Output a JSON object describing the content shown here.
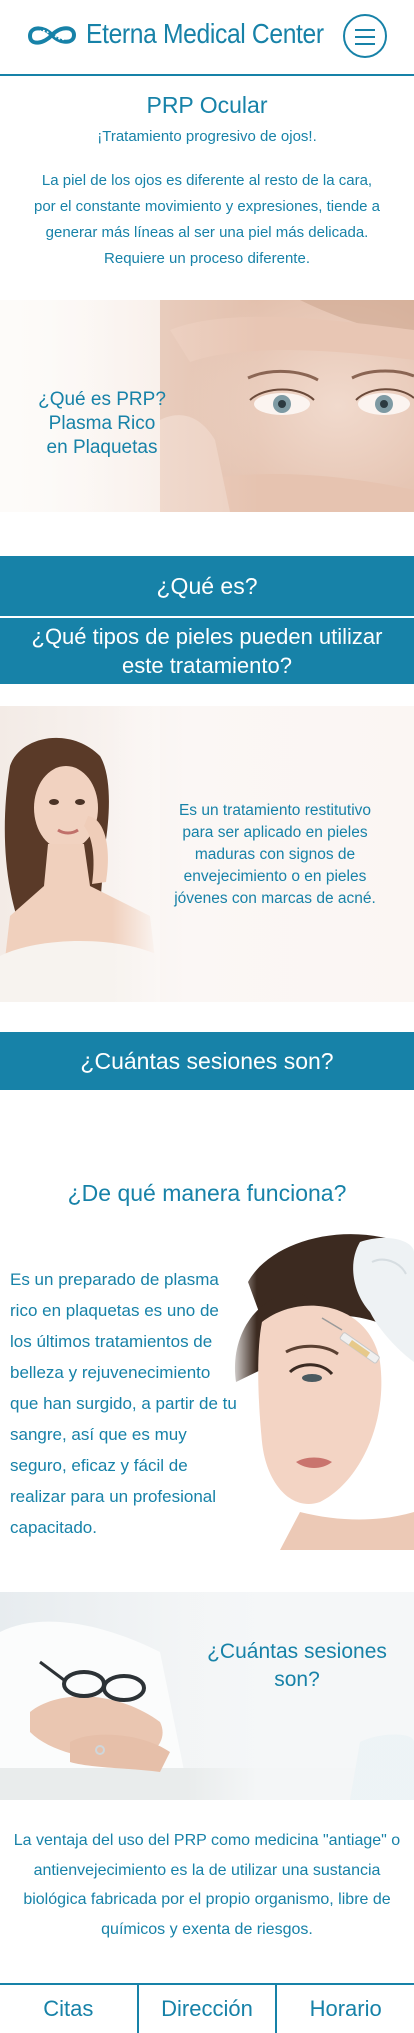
{
  "header": {
    "brand": "Eterna Medical Center",
    "logo_icon": "infinity-logo-icon",
    "menu_icon": "hamburger-menu-icon"
  },
  "intro": {
    "title": "PRP Ocular",
    "subtitle": "¡Tratamiento progresivo de ojos!.",
    "text": "La piel de los ojos es diferente al resto de la cara, por el constante movimiento y expresiones, tiende a generar más líneas al ser una piel más delicada. Requiere un proceso diferente."
  },
  "hero": {
    "line1": "¿Qué es PRP?",
    "line2": "Plasma Rico",
    "line3": "en Plaquetas"
  },
  "bands": {
    "what_is": "¿Qué es?",
    "skin_types_line1": "¿Qué tipos de pieles pueden utilizar",
    "skin_types_line2": "este tratamiento?",
    "sessions": "¿Cuántas sesiones son?"
  },
  "woman1": {
    "text": "Es un tratamiento restitutivo para ser aplicado en pieles maduras con signos de envejecimiento o en pieles jóvenes con marcas de acné."
  },
  "how": {
    "title": "¿De qué manera funciona?",
    "text": "Es un preparado de plasma rico en plaquetas es uno de los últimos tratamientos de belleza y rejuvenecimiento que han surgido, a partir de tu sangre, así que es muy seguro, eficaz y fácil de realizar para un profesional capacitado."
  },
  "doctor": {
    "line1": "¿Cuántas sesiones",
    "line2": "son?"
  },
  "final": {
    "text": "La ventaja del uso del PRP como medicina \"antiage\" o antienvejecimiento es la de utilizar una sustancia biológica fabricada por el propio organismo, libre de químicos y exenta de riesgos."
  },
  "nav": {
    "citas": "Citas",
    "direccion": "Dirección",
    "horario": "Horario"
  },
  "colors": {
    "brand": "#1782a8",
    "background": "#ffffff",
    "band_text": "#ffffff"
  }
}
